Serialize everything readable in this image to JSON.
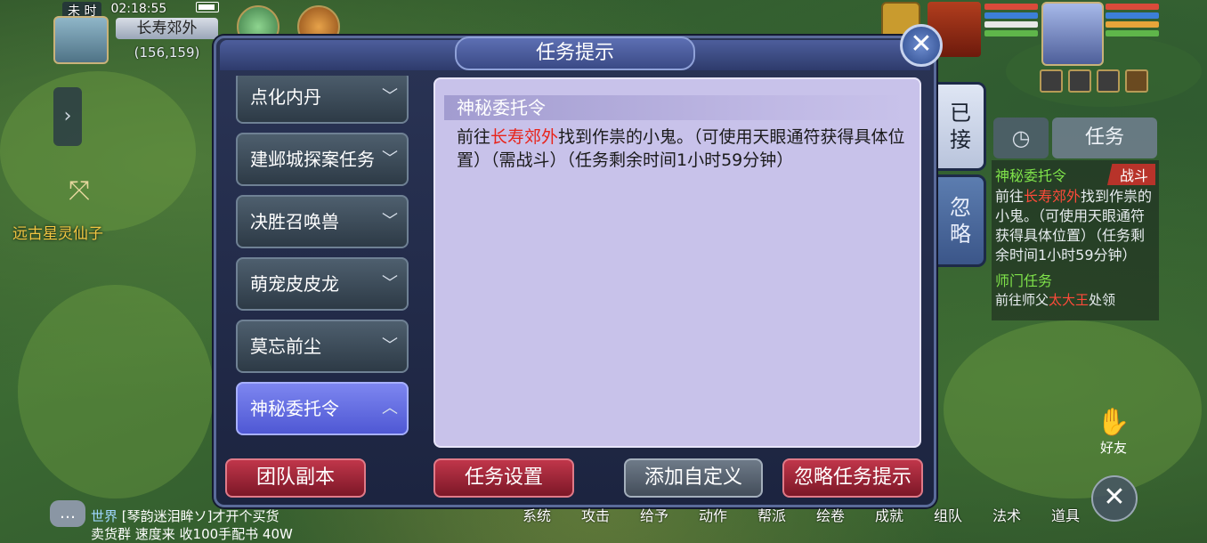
{
  "hud": {
    "period": "未 时",
    "time": "02:18:55",
    "location": "长寿郊外",
    "coords": "(156,159)",
    "npc_name": "远古星灵仙子"
  },
  "dialog": {
    "title": "任务提示",
    "close_symbol": "✕",
    "tasks": [
      {
        "label": "点化内丹",
        "chevron": "﹀"
      },
      {
        "label": "建邺城探案任务",
        "chevron": "﹀"
      },
      {
        "label": "决胜召唤兽",
        "chevron": "﹀"
      },
      {
        "label": "萌宠皮皮龙",
        "chevron": "﹀"
      },
      {
        "label": "莫忘前尘",
        "chevron": "﹀"
      },
      {
        "label": "神秘委托令",
        "chevron": "︿"
      }
    ],
    "detail": {
      "title": "神秘委托令",
      "prefix": "前往",
      "place": "长寿郊外",
      "rest": "找到作祟的小鬼。（可使用天眼通符获得具体位置）（需战斗）（任务剩余时间1小时59分钟）"
    },
    "buttons": {
      "team_dungeon": "团队副本",
      "task_settings": "任务设置",
      "add_custom": "添加自定义",
      "ignore_hint": "忽略任务提示"
    }
  },
  "side_tabs": {
    "accepted": [
      "已",
      "接"
    ],
    "ignored": [
      "忽",
      "略"
    ]
  },
  "tracker": {
    "clock_icon": "◷",
    "tab_label": "任务",
    "task_title": "神秘委托令",
    "fight_badge": "战斗",
    "desc_prefix": "前往",
    "desc_place": "长寿郊外",
    "desc_rest": "找到作祟的小鬼。（可使用天眼通符获得具体位置）（任务剩余时间1小时59分钟）",
    "second_title": "师门任务",
    "second_prefix": "前往师父",
    "second_place": "太大王",
    "second_rest": "处领"
  },
  "chat": {
    "channel": "世界",
    "line1": "[琴韵迷泪眸ソ]才开个买货",
    "line2": "卖货群 速度来 收100手配书 40W"
  },
  "bottom_menu": [
    "系统",
    "攻击",
    "给予",
    "动作",
    "帮派",
    "绘卷",
    "成就",
    "组队",
    "法术",
    "道具"
  ],
  "friend_label": "好友",
  "colors": {
    "dialog_bg": "#1c2440",
    "detail_bg": "#c8c2ea",
    "active_tab": "#5a62dc",
    "red_button": "#a02638",
    "highlight_red": "#e8231a",
    "tracker_green": "#7fe24a"
  }
}
